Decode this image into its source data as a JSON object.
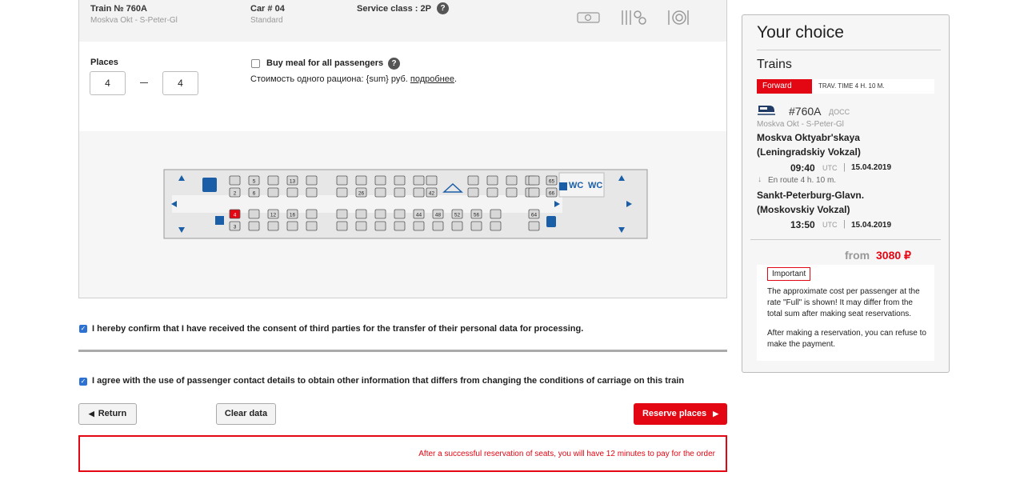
{
  "train": {
    "number_label": "Train №  760A",
    "route": "Moskva Okt - S-Peter-Gl",
    "car_label": "Car # 04",
    "car_type": "Standard",
    "service_class": "Service class : 2P",
    "help_glyph": "?"
  },
  "places": {
    "label": "Places",
    "from_value": "4",
    "to_value": "4"
  },
  "meal": {
    "label": "Buy meal for all passengers",
    "cost_text": "Стоимость одного рациона: {sum} руб. ",
    "cost_link": "подробнее",
    "cost_end": "."
  },
  "car_map": {
    "wc_label": "WC",
    "top_row_upper": [
      "",
      "5",
      "",
      "13",
      "",
      "",
      "",
      "",
      "",
      "",
      "",
      "",
      "",
      "",
      "",
      "",
      "65"
    ],
    "top_row_lower": [
      "2",
      "6",
      "",
      "",
      "",
      "",
      "26",
      "",
      "",
      "",
      "42",
      "",
      "",
      "",
      "",
      "",
      "66"
    ],
    "bottom_row_upper": [
      "4",
      "",
      "12",
      "16",
      "",
      "",
      "",
      "",
      "",
      "44",
      "48",
      "52",
      "56",
      "",
      "64"
    ],
    "bottom_row_lower": [
      "3",
      "",
      "",
      "",
      "",
      "",
      "",
      "",
      "",
      "",
      "",
      "",
      "",
      "",
      ""
    ],
    "selected_seat": "4",
    "colors": {
      "seat_border": "#555555",
      "seat_fill": "#d8d8d8",
      "selected_fill": "#e30613",
      "accent_blue": "#1a5ea8"
    }
  },
  "consents": {
    "consent_1": "I hereby confirm that I have received the consent of third parties for the transfer of their personal data for processing.",
    "consent_2": "I agree with the use of passenger contact details to obtain other information that differs from changing the conditions of carriage on this train",
    "check_glyph": "✓"
  },
  "buttons": {
    "return_label": "Return",
    "clear_label": "Clear data",
    "reserve_label": "Reserve places"
  },
  "notice": "After a successful reservation of seats, you will have 12 minutes to pay for the order",
  "sidebar": {
    "title": "Your choice",
    "trains_label": "Trains",
    "direction": "Forward",
    "travel_time": "TRAV. TIME 4 H. 10 M.",
    "train_number": "#760A",
    "train_type": "ДОСС",
    "route": "Moskva Okt - S-Peter-Gl",
    "departure": {
      "station": "Moskva Oktyabr'skaya (Leningradskiy Vokzal)",
      "time": "09:40",
      "utc": "UTC",
      "date": "15.04.2019"
    },
    "en_route": "En route  4 h. 10 m.",
    "arrival": {
      "station": "Sankt-Peterburg-Glavn. (Moskovskiy Vokzal)",
      "time": "13:50",
      "utc": "UTC",
      "date": "15.04.2019"
    },
    "separator": "|",
    "from_label": "from",
    "price": "3080 ₽",
    "important_tag": "Important",
    "important_text_1": "The approximate cost per passenger at the rate \"Full\" is shown! It may differ from the total sum after making seat reservations.",
    "important_text_2": "After making a reservation, you can refuse to make the payment."
  }
}
